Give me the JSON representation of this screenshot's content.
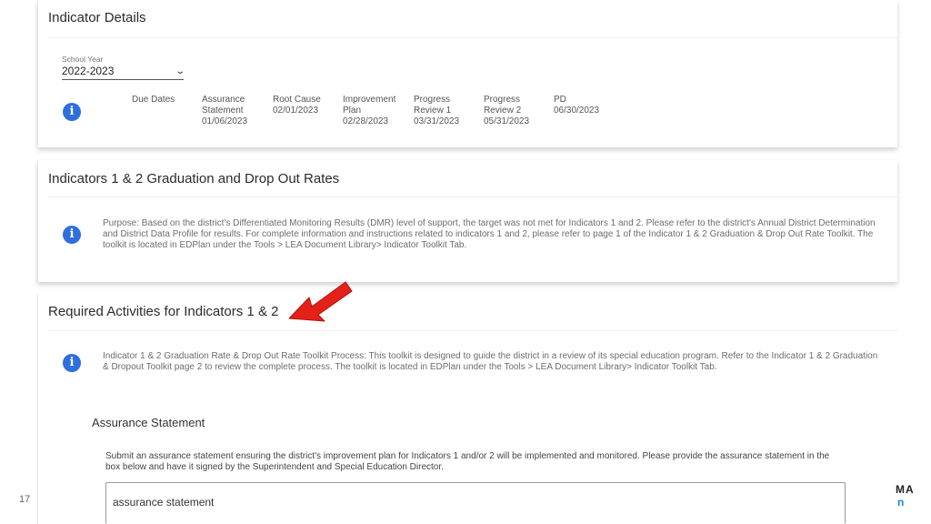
{
  "indicator_details": {
    "title": "Indicator Details",
    "school_year": {
      "label": "School Year",
      "value": "2022-2023"
    },
    "due_dates": {
      "label": "Due Dates",
      "items": [
        {
          "lines": [
            "Assurance",
            "Statement",
            "01/06/2023"
          ]
        },
        {
          "lines": [
            "Root Cause",
            "02/01/2023"
          ]
        },
        {
          "lines": [
            "Improvement",
            "Plan",
            "02/28/2023"
          ]
        },
        {
          "lines": [
            "Progress",
            "Review 1",
            "03/31/2023"
          ]
        },
        {
          "lines": [
            "Progress",
            "Review 2",
            "05/31/2023"
          ]
        },
        {
          "lines": [
            "PD",
            "06/30/2023"
          ]
        }
      ]
    }
  },
  "graduation_card": {
    "title": "Indicators 1 & 2 Graduation and Drop Out Rates",
    "purpose": "Purpose: Based on the district's Differentiated Monitoring Results (DMR) level of support, the target was not met for Indicators 1 and 2. Please refer to the district's Annual District Determination and District Data Profile for results. For complete information and instructions related to indicators 1 and 2, please refer to page 1 of the Indicator 1 & 2 Graduation & Drop Out Rate Toolkit. The toolkit is located in EDPlan under the Tools > LEA Document Library> Indicator Toolkit Tab."
  },
  "required_activities": {
    "title": "Required Activities for Indicators 1 & 2",
    "toolkit_text": "Indicator 1 & 2 Graduation Rate & Drop Out Rate Toolkit Process: This toolkit is designed to guide the district in a review of its special education program. Refer to the Indicator 1 & 2 Graduation & Dropout Toolkit page 2 to review the complete process. The toolkit is located in EDPlan under the Tools > LEA Document Library> Indicator Toolkit Tab.",
    "assurance": {
      "heading": "Assurance Statement",
      "description": "Submit an assurance statement ensuring the district's improvement plan for Indicators 1 and/or 2 will be implemented and monitored. Please provide the assurance statement in the box below and have it signed by the Superintendent and Special Education Director.",
      "input_value": "assurance statement"
    }
  },
  "slide": {
    "number": "17",
    "logo_line1": "MA",
    "logo_line2": "n"
  },
  "icons": {
    "info": "info-icon",
    "arrow": "red-arrow-icon",
    "chevron": "chevron-down-icon"
  },
  "colors": {
    "info_blue": "#2f6fdc",
    "arrow_red": "#e32119",
    "logo_blue": "#1a8bd3"
  }
}
